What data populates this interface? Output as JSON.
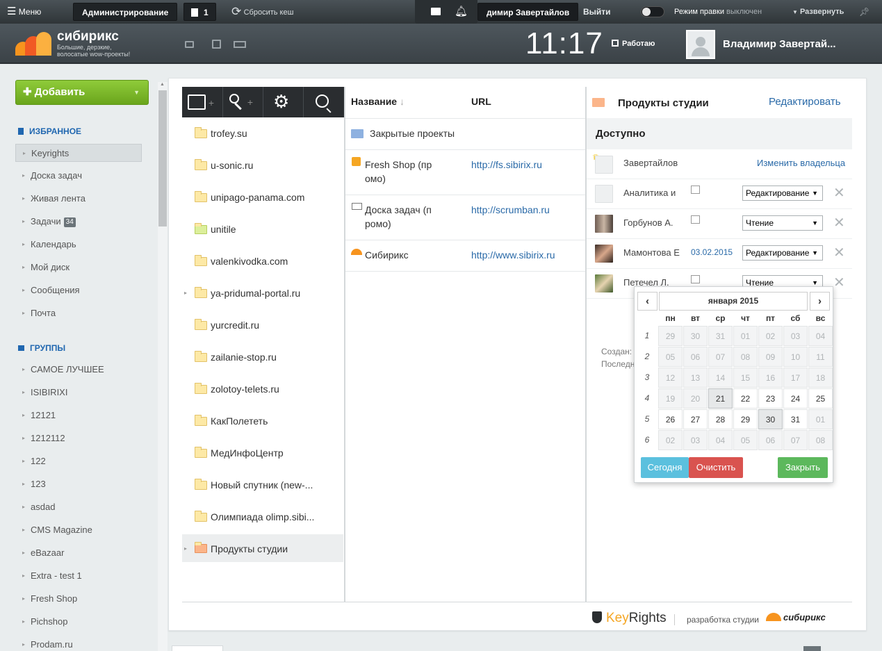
{
  "adminbar": {
    "menu": "Меню",
    "admin": "Администрирование",
    "notif_count": "1",
    "reset_cache": "Сбросить кеш",
    "user": "димир Завертайлов",
    "logout": "Выйти",
    "edit_mode_label": "Режим правки",
    "edit_mode_state": "выключен",
    "expand": "Развернуть"
  },
  "header": {
    "logo_name": "сибирикс",
    "logo_tag1": "Большие, дерзкие,",
    "logo_tag2": "волосатые wow-проекты!",
    "clock": "11:17",
    "work_status": "Работаю",
    "user_name": "Владимир Завертай..."
  },
  "leftmenu": {
    "add": "Добавить",
    "fav_title": "Избранное",
    "fav": [
      "Keyrights",
      "Доска задач",
      "Живая лента",
      "Задачи",
      "Календарь",
      "Мой диск",
      "Сообщения",
      "Почта"
    ],
    "tasks_badge": "34",
    "groups_title": "Группы",
    "groups": [
      "САМОЕ ЛУЧШЕЕ",
      "ISIBIRIXI",
      "12121",
      "1212112",
      "122",
      "123",
      "asdad",
      "CMS Magazine",
      "eBazaar",
      "Extra - test 1",
      "Fresh Shop",
      "Pichshop",
      "Prodam.ru"
    ]
  },
  "tree": {
    "items": [
      "trofey.su",
      "u-sonic.ru",
      "unipago-panama.com",
      "unitile",
      "valenkivodka.com",
      "ya-pridumal-portal.ru",
      "yurcredit.ru",
      "zailanie-stop.ru",
      "zolotoy-telets.ru",
      "КакПолететь",
      "МедИнфоЦентр",
      "Новый спутник (new-...",
      "Олимпиада olimp.sibi...",
      "Продукты студии"
    ]
  },
  "list": {
    "col_name": "Название",
    "col_url": "URL",
    "rows": [
      {
        "name": "Закрытые проекты",
        "url": ""
      },
      {
        "name1": "Fresh Shop (пр",
        "name2": "омо)",
        "url": "http://fs.sibirix.ru"
      },
      {
        "name1": "Доска задач (п",
        "name2": "ромо)",
        "url": "http://scrumban.ru"
      },
      {
        "name": "Сибирикс",
        "url": "http://www.sibirix.ru"
      }
    ]
  },
  "detail": {
    "title": "Продукты студии",
    "edit": "Редактировать",
    "access": "Доступно",
    "owner": "Завертайлов",
    "change_owner": "Изменить владельца",
    "rows": [
      {
        "name": "Аналитика и",
        "date": "",
        "perm": "Редактирование"
      },
      {
        "name": "Горбунов А.",
        "date": "",
        "perm": "Чтение"
      },
      {
        "name": "Мамонтова Е",
        "date": "03.02.2015",
        "perm": "Редактирование"
      },
      {
        "name": "Петечел Л.",
        "date": "",
        "perm": "Чтение"
      }
    ],
    "created": "Создан:",
    "last": "Последн"
  },
  "calendar": {
    "month": "января 2015",
    "dow": [
      "пн",
      "вт",
      "ср",
      "чт",
      "пт",
      "сб",
      "вс"
    ],
    "weeks": [
      {
        "n": "1",
        "d": [
          "29",
          "30",
          "31",
          "01",
          "02",
          "03",
          "04"
        ]
      },
      {
        "n": "2",
        "d": [
          "05",
          "06",
          "07",
          "08",
          "09",
          "10",
          "11"
        ]
      },
      {
        "n": "3",
        "d": [
          "12",
          "13",
          "14",
          "15",
          "16",
          "17",
          "18"
        ]
      },
      {
        "n": "4",
        "d": [
          "19",
          "20",
          "21",
          "22",
          "23",
          "24",
          "25"
        ]
      },
      {
        "n": "5",
        "d": [
          "26",
          "27",
          "28",
          "29",
          "30",
          "31",
          "01"
        ]
      },
      {
        "n": "6",
        "d": [
          "02",
          "03",
          "04",
          "05",
          "06",
          "07",
          "08"
        ]
      }
    ],
    "today": "Сегодня",
    "clear": "Очистить",
    "close": "Закрыть"
  },
  "footer": {
    "brand_key": "Key",
    "brand_rights": "Rights",
    "dev": "разработка студии",
    "studio": "сибирикс"
  },
  "colors": {
    "add_green": "#7cba24",
    "blue_link": "#2a6aa8",
    "today_btn": "#5bc0de",
    "clear_btn": "#d9534f",
    "close_btn": "#5cb85c"
  }
}
